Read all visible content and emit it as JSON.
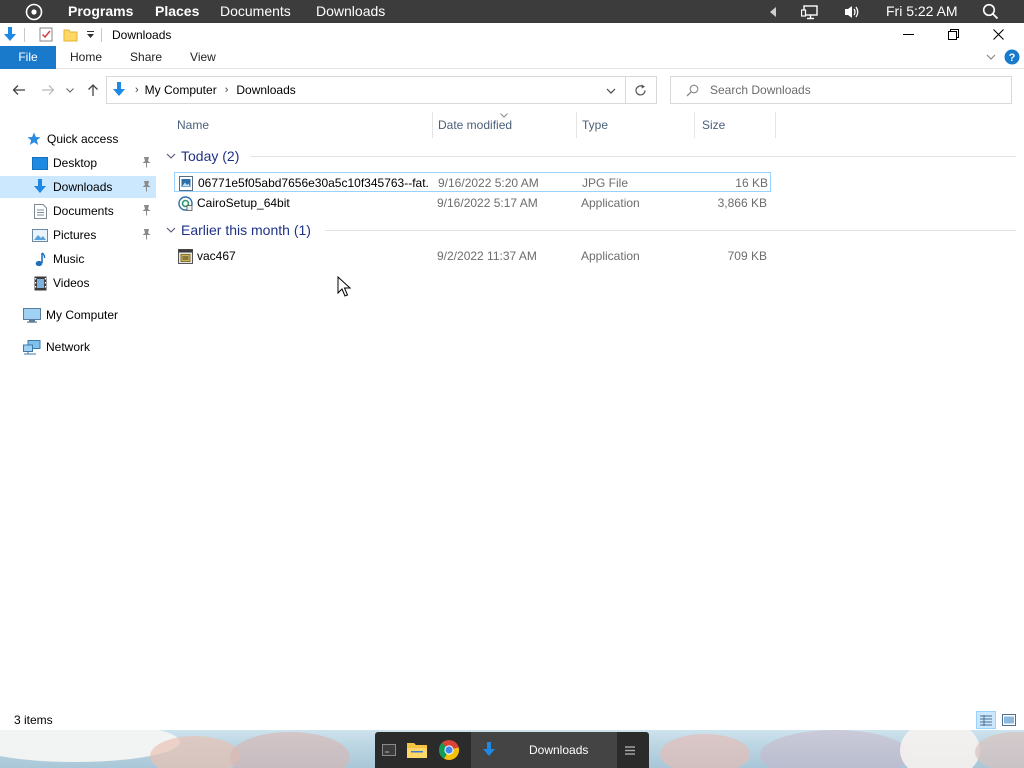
{
  "top_panel": {
    "menus": [
      "Programs",
      "Places",
      "Documents",
      "Downloads"
    ],
    "clock": "Fri 5:22 AM"
  },
  "window": {
    "title": "Downloads",
    "ribbon_tabs": {
      "file": "File",
      "home": "Home",
      "share": "Share",
      "view": "View"
    }
  },
  "address": {
    "crumbs": [
      "My Computer",
      "Downloads"
    ],
    "search_placeholder": "Search Downloads"
  },
  "nav": {
    "quick_access": "Quick access",
    "items": [
      {
        "label": "Desktop",
        "icon": "desktop-icon",
        "pinned": true
      },
      {
        "label": "Downloads",
        "icon": "downloads-icon",
        "pinned": true,
        "selected": true
      },
      {
        "label": "Documents",
        "icon": "documents-icon",
        "pinned": true
      },
      {
        "label": "Pictures",
        "icon": "pictures-icon",
        "pinned": true
      },
      {
        "label": "Music",
        "icon": "music-icon",
        "pinned": false
      },
      {
        "label": "Videos",
        "icon": "videos-icon",
        "pinned": false
      }
    ],
    "my_computer": "My Computer",
    "network": "Network"
  },
  "columns": {
    "name": "Name",
    "date": "Date modified",
    "type": "Type",
    "size": "Size"
  },
  "groups": [
    {
      "label": "Today (2)",
      "files": [
        {
          "name": "06771e5f05abd7656e30a5c10f345763--fat...",
          "date": "9/16/2022 5:20 AM",
          "type": "JPG File",
          "size": "16 KB",
          "icon": "jpg-file-icon"
        },
        {
          "name": "CairoSetup_64bit",
          "date": "9/16/2022 5:17 AM",
          "type": "Application",
          "size": "3,866 KB",
          "icon": "setup-app-icon"
        }
      ]
    },
    {
      "label": "Earlier this month (1)",
      "files": [
        {
          "name": "vac467",
          "date": "9/2/2022 11:37 AM",
          "type": "Application",
          "size": "709 KB",
          "icon": "application-icon"
        }
      ]
    }
  ],
  "status": {
    "items": "3 items"
  },
  "dock": {
    "active_label": "Downloads"
  }
}
